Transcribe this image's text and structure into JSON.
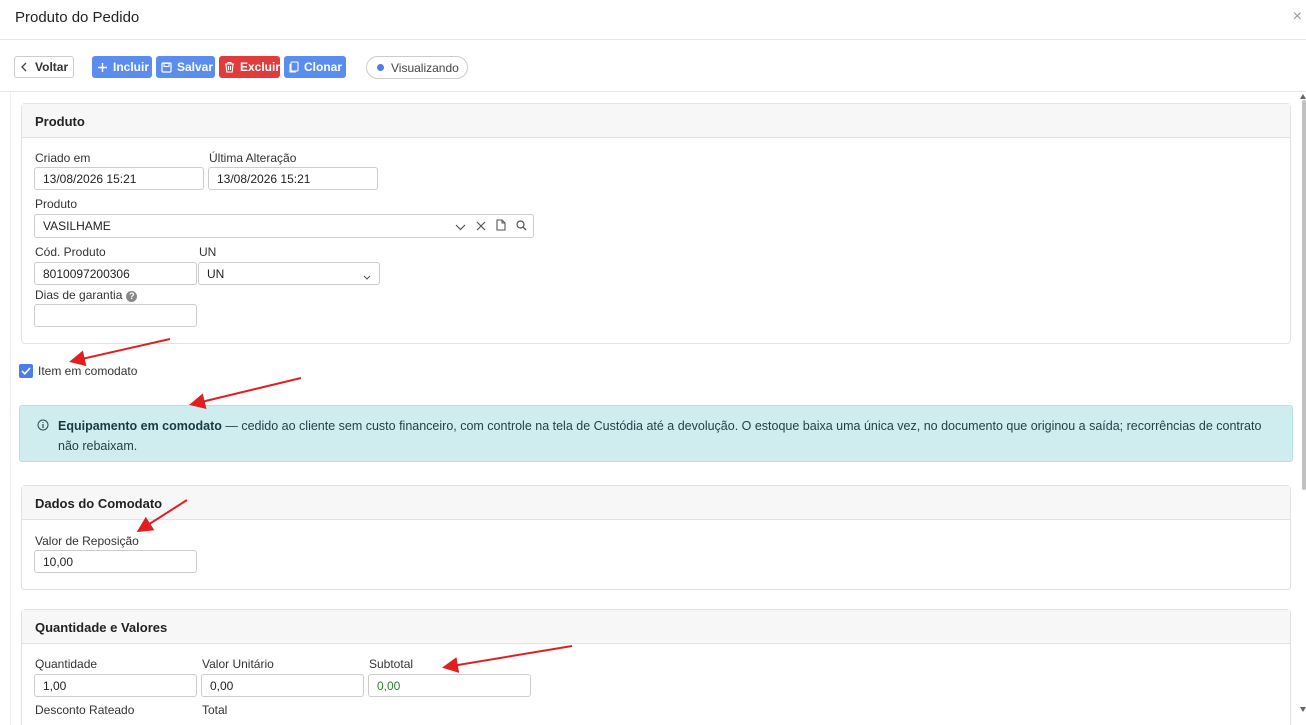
{
  "header": {
    "title": "Produto do Pedido",
    "close_glyph": "×"
  },
  "toolbar": {
    "back_label": "Voltar",
    "include_label": "Incluir",
    "save_label": "Salvar",
    "delete_label": "Excluir",
    "clone_label": "Clonar",
    "status_label": "Visualizando"
  },
  "produto_section": {
    "title": "Produto",
    "created_label": "Criado em",
    "created_value": "13/08/2026 15:21",
    "updated_label": "Última Alteração",
    "updated_value": "13/08/2026 15:21",
    "product_label": "Produto",
    "product_value": "VASILHAME",
    "code_label": "Cód. Produto",
    "code_value": "8010097200306",
    "unit_label": "UN",
    "unit_value": "UN",
    "warranty_label": "Dias de garantia",
    "warranty_value": "",
    "help_glyph": "?"
  },
  "comodato_checkbox": {
    "label": "Item em comodato",
    "checked": true
  },
  "info_alert": {
    "title": "Equipamento em comodato",
    "text": " — cedido ao cliente sem custo financeiro, com controle na tela de Custódia até a devolução. O estoque baixa uma única vez, no documento que originou a saída; recorrências de contrato não rebaixam."
  },
  "comodato_section": {
    "title": "Dados do Comodato",
    "replacement_label": "Valor de Reposição",
    "replacement_value": "10,00"
  },
  "values_section": {
    "title": "Quantidade e Valores",
    "qty_label": "Quantidade",
    "qty_value": "1,00",
    "unit_price_label": "Valor Unitário",
    "unit_price_value": "0,00",
    "subtotal_label": "Subtotal",
    "subtotal_value": "0,00",
    "discount_label": "Desconto Rateado",
    "total_label": "Total"
  },
  "colors": {
    "primary": "#5b8def",
    "danger": "#e03c3c",
    "info_bg": "#cfecef",
    "annotation": "#e02020",
    "checkbox": "#4a7de8"
  }
}
